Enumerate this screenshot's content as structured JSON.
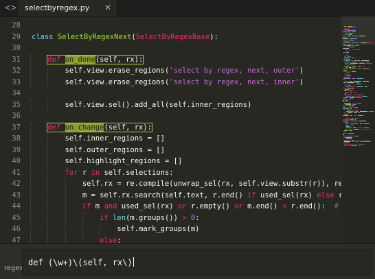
{
  "tabbar": {
    "back_glyph": "<",
    "forward_glyph": ">",
    "tab": {
      "label": "selectbyregex.py",
      "close_glyph": "✕"
    }
  },
  "editor": {
    "line_numbers": [
      "28",
      "29",
      "30",
      "31",
      "32",
      "33",
      "34",
      "35",
      "36",
      "37",
      "38",
      "39",
      "40",
      "41",
      "42",
      "43",
      "44",
      "45",
      "46",
      "47"
    ],
    "lines": [
      {
        "parts": []
      },
      {
        "parts": [
          [
            "cls-kw",
            "class"
          ],
          [
            "plain",
            " "
          ],
          [
            "cls",
            "SelectByRegexNext"
          ],
          [
            "plain",
            "("
          ],
          [
            "inh",
            "SelectByRegexBase"
          ],
          [
            "plain",
            "):"
          ]
        ]
      },
      {
        "parts": []
      },
      {
        "parts": [
          [
            "kw",
            "def"
          ],
          [
            "plain",
            " "
          ],
          [
            "fnhl",
            "on_done"
          ],
          [
            "plain",
            "(self, rx):"
          ]
        ],
        "match_box": true
      },
      {
        "parts": [
          [
            "plain",
            "self.view.erase_regions("
          ],
          [
            "strm",
            "'select by regex, next, outer'"
          ],
          [
            "plain",
            ")"
          ]
        ]
      },
      {
        "parts": [
          [
            "plain",
            "self.view.erase_regions("
          ],
          [
            "strm",
            "'select by regex, next, inner'"
          ],
          [
            "plain",
            ")"
          ]
        ]
      },
      {
        "parts": []
      },
      {
        "parts": [
          [
            "plain",
            "self.view.sel().add_all(self.inner_regions)"
          ]
        ]
      },
      {
        "parts": []
      },
      {
        "parts": [
          [
            "kw",
            "def"
          ],
          [
            "plain",
            " "
          ],
          [
            "fnhl",
            "on_change"
          ],
          [
            "plain",
            "(self, rx):"
          ]
        ],
        "match_box": true
      },
      {
        "parts": [
          [
            "plain",
            "self.inner_regions = []"
          ]
        ]
      },
      {
        "parts": [
          [
            "plain",
            "self.outer_regions = []"
          ]
        ]
      },
      {
        "parts": [
          [
            "plain",
            "self.highlight_regions = []"
          ]
        ]
      },
      {
        "parts": [
          [
            "kw",
            "for"
          ],
          [
            "plain",
            " r "
          ],
          [
            "kw",
            "in"
          ],
          [
            "plain",
            " self.selections:"
          ]
        ]
      },
      {
        "parts": [
          [
            "plain",
            "self.rx = re.compile(unwrap_sel(rx, self.view.substr(r)), re.MULTILINE)"
          ]
        ]
      },
      {
        "parts": [
          [
            "plain",
            "m = self.rx.search(self.text, r.end() "
          ],
          [
            "kw",
            "if"
          ],
          [
            "plain",
            " used_sel(rx) "
          ],
          [
            "kw",
            "else"
          ],
          [
            "plain",
            " r.begin())"
          ]
        ]
      },
      {
        "parts": [
          [
            "kw",
            "if"
          ],
          [
            "plain",
            " m "
          ],
          [
            "kw",
            "and"
          ],
          [
            "plain",
            " used_sel(rx) "
          ],
          [
            "kw",
            "or"
          ],
          [
            "plain",
            " r.empty() "
          ],
          [
            "kw",
            "or"
          ],
          [
            "plain",
            " m.end() "
          ],
          [
            "kw",
            "<"
          ],
          [
            "plain",
            " r.end():  "
          ],
          [
            "cm",
            "# Restrict to selection if it"
          ]
        ]
      },
      {
        "parts": [
          [
            "kw",
            "if"
          ],
          [
            "plain",
            " "
          ],
          [
            "fnc",
            "len"
          ],
          [
            "plain",
            "(m.groups()) "
          ],
          [
            "kw",
            ">"
          ],
          [
            "plain",
            " "
          ],
          [
            "num",
            "0"
          ],
          [
            "plain",
            ":"
          ]
        ]
      },
      {
        "parts": [
          [
            "plain",
            "self.mark_groups(m)"
          ]
        ]
      },
      {
        "parts": [
          [
            "kw",
            "else"
          ],
          [
            "plain",
            ":"
          ]
        ]
      }
    ],
    "indent_levels": [
      0,
      0,
      0,
      1,
      2,
      2,
      0,
      2,
      0,
      1,
      2,
      2,
      2,
      2,
      3,
      3,
      3,
      4,
      5,
      4
    ]
  },
  "findbar": {
    "label": "regex",
    "query": "def (\\w+)\\(self, rx\\)"
  },
  "colors": {
    "background": "#272822",
    "keyword": "#f92672",
    "function": "#a6e22e",
    "string": "#c86adf",
    "comment": "#75715e",
    "number": "#ae81ff",
    "match_highlight": "#a6e22e"
  }
}
